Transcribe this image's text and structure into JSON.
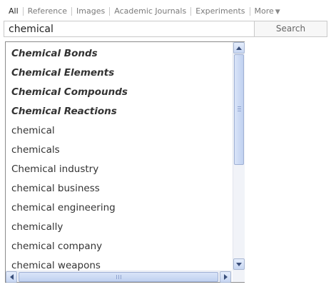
{
  "tabs": [
    {
      "label": "All",
      "active": true
    },
    {
      "label": "Reference",
      "active": false
    },
    {
      "label": "Images",
      "active": false
    },
    {
      "label": "Academic Journals",
      "active": false
    },
    {
      "label": "Experiments",
      "active": false
    }
  ],
  "more_label": "More",
  "search": {
    "value": "chemical",
    "button_label": "Search"
  },
  "suggestions": [
    {
      "text": "Chemical Bonds",
      "bold": true
    },
    {
      "text": "Chemical Elements",
      "bold": true
    },
    {
      "text": "Chemical Compounds",
      "bold": true
    },
    {
      "text": "Chemical Reactions",
      "bold": true
    },
    {
      "text": "chemical",
      "bold": false
    },
    {
      "text": "chemicals",
      "bold": false
    },
    {
      "text": "Chemical industry",
      "bold": false
    },
    {
      "text": "chemical business",
      "bold": false
    },
    {
      "text": "chemical engineering",
      "bold": false
    },
    {
      "text": "chemically",
      "bold": false
    },
    {
      "text": "chemical company",
      "bold": false
    },
    {
      "text": "chemical weapons",
      "bold": false
    }
  ],
  "icons": {
    "more": "caret-down-icon",
    "scroll_up": "arrow-up-icon",
    "scroll_down": "arrow-down-icon",
    "scroll_left": "arrow-left-icon",
    "scroll_right": "arrow-right-icon"
  }
}
